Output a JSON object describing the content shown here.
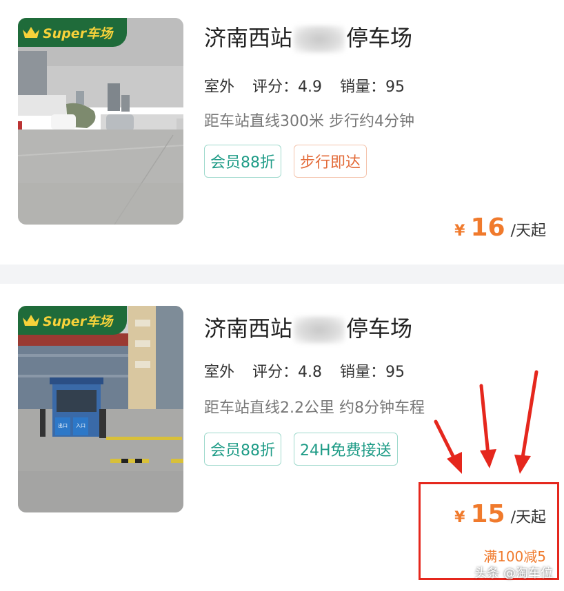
{
  "listings": [
    {
      "badge": "Super车场",
      "title_prefix": "济南西站",
      "title_suffix": "停车场",
      "type": "室外",
      "rating_label": "评分：",
      "rating": "4.9",
      "sales_label": "销量：",
      "sales": "95",
      "distance": "距车站直线300米 步行约4分钟",
      "tags": [
        {
          "label": "会员88折",
          "color": "green"
        },
        {
          "label": "步行即达",
          "color": "orange"
        }
      ],
      "price_symbol": "¥",
      "price": "16",
      "price_unit": "/天起"
    },
    {
      "badge": "Super车场",
      "title_prefix": "济南西站",
      "title_suffix": "停车场",
      "type": "室外",
      "rating_label": "评分：",
      "rating": "4.8",
      "sales_label": "销量：",
      "sales": "95",
      "distance": "距车站直线2.2公里 约8分钟车程",
      "tags": [
        {
          "label": "会员88折",
          "color": "green"
        },
        {
          "label": "24H免费接送",
          "color": "green"
        }
      ],
      "price_symbol": "¥",
      "price": "15",
      "price_unit": "/天起",
      "discount": "满100减5"
    }
  ],
  "booth_sign_left": "出口",
  "booth_sign_right": "入口",
  "watermark": "头条 @淘车位",
  "colors": {
    "price_orange": "#f07a2c",
    "tag_green": "#1d9b86",
    "tag_orange": "#e36b39",
    "badge_green": "#1f6b3a",
    "highlight_red": "#e5271d"
  },
  "icons": [
    "crown-icon",
    "red-arrow-icon"
  ]
}
